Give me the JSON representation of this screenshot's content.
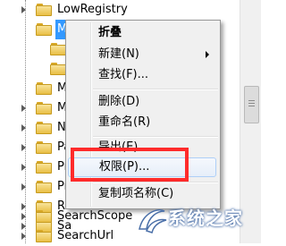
{
  "tree": {
    "rows": [
      {
        "label": "LowRegistry"
      },
      {
        "label": "M"
      },
      {
        "label": ""
      },
      {
        "label": ""
      },
      {
        "label": "M"
      },
      {
        "label": "M"
      },
      {
        "label": "N"
      },
      {
        "label": "Pa"
      },
      {
        "label": "Pr"
      },
      {
        "label": "Pr"
      },
      {
        "label": "Re"
      },
      {
        "label": "Sa"
      },
      {
        "label": "SearchScope"
      },
      {
        "label": "SearchUrl"
      }
    ]
  },
  "context_menu": {
    "items": [
      {
        "label": "折叠"
      },
      {
        "label": "新建(N)"
      },
      {
        "label": "查找(F)..."
      },
      {
        "label": "删除(D)"
      },
      {
        "label": "重命名(R)"
      },
      {
        "label": "导出(E)"
      },
      {
        "label": "权限(P)..."
      },
      {
        "label": "复制项名称(C)"
      }
    ]
  },
  "colors": {
    "annotation": "#ff2b2b",
    "selection": "#3399ff",
    "folder": "#e9bf45"
  },
  "watermark": {
    "text": "系统之家"
  }
}
